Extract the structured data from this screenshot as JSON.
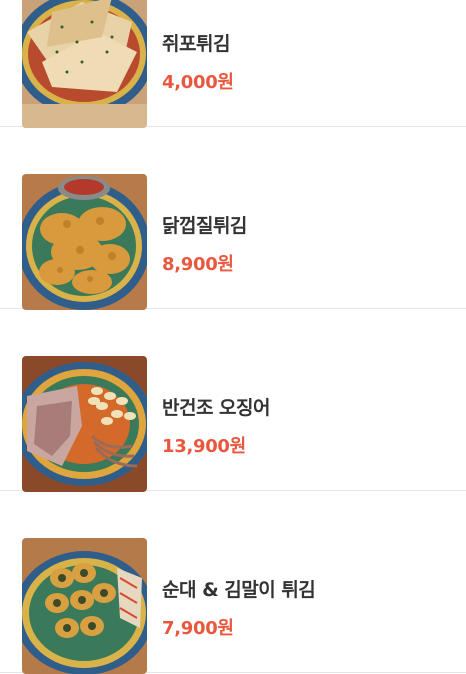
{
  "menu": {
    "items": [
      {
        "name": "쥐포튀김",
        "price": "4,000원",
        "image": "fried-filefish-jerky-photo"
      },
      {
        "name": "닭껍질튀김",
        "price": "8,900원",
        "image": "fried-chicken-skin-photo"
      },
      {
        "name": "반건조 오징어",
        "price": "13,900원",
        "image": "half-dried-squid-photo"
      },
      {
        "name": "순대 & 김말이 튀김",
        "price": "7,900원",
        "image": "fried-sundae-gimmari-photo"
      }
    ]
  },
  "colors": {
    "price": "#e8583f",
    "name": "#333333",
    "divider": "#e6e6e6"
  }
}
